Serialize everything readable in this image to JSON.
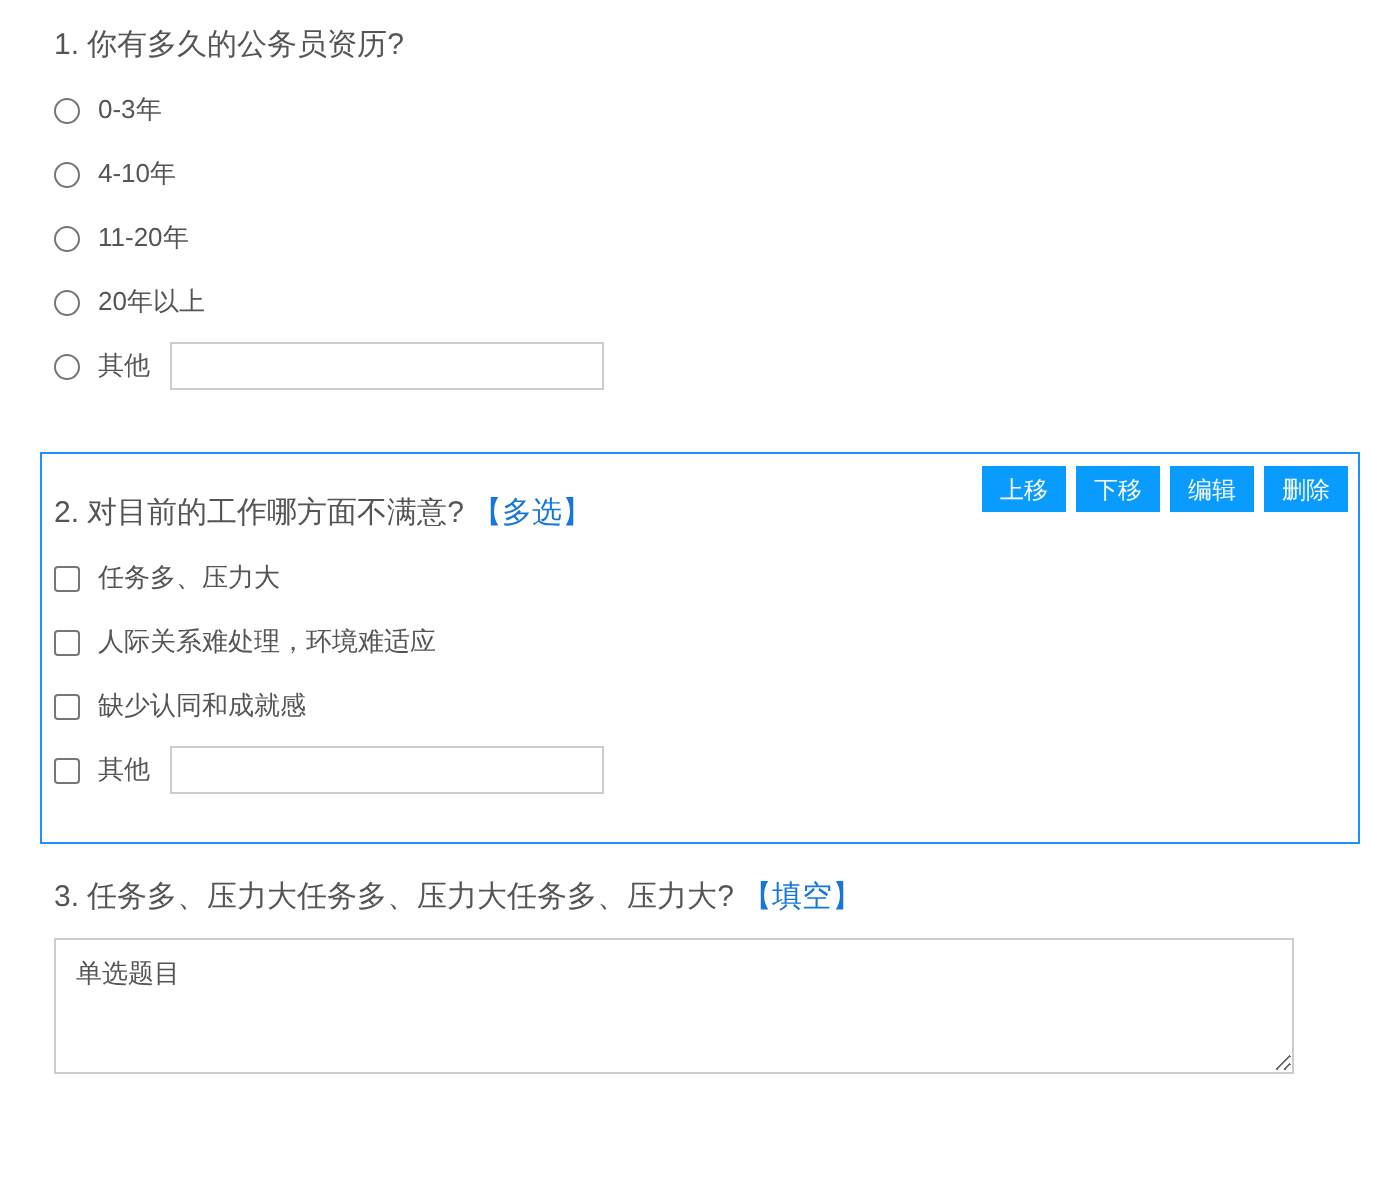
{
  "questions": [
    {
      "kind": "radio",
      "title": "1. 你有多久的公务员资历?",
      "active": false,
      "options": [
        {
          "label": "0-3年",
          "selected": false
        },
        {
          "label": "4-10年",
          "selected": false
        },
        {
          "label": "11-20年",
          "selected": false
        },
        {
          "label": "20年以上",
          "selected": false
        },
        {
          "label": "其他",
          "selected": false,
          "has_input": true
        }
      ]
    },
    {
      "kind": "checkbox",
      "title": "2. 对目前的工作哪方面不满意?",
      "tag": "【多选】",
      "active": true,
      "actions": [
        "上移",
        "下移",
        "编辑",
        "删除"
      ],
      "options": [
        {
          "label": "任务多、压力大",
          "checked": false
        },
        {
          "label": "人际关系难处理，环境难适应",
          "checked": false
        },
        {
          "label": "缺少认同和成就感",
          "checked": false
        },
        {
          "label": "其他",
          "checked": false,
          "has_input": true
        }
      ]
    },
    {
      "kind": "text",
      "title": "3. 任务多、压力大任务多、压力大任务多、压力大?",
      "tag": "【填空】",
      "active": false,
      "value": "单选题目"
    }
  ]
}
